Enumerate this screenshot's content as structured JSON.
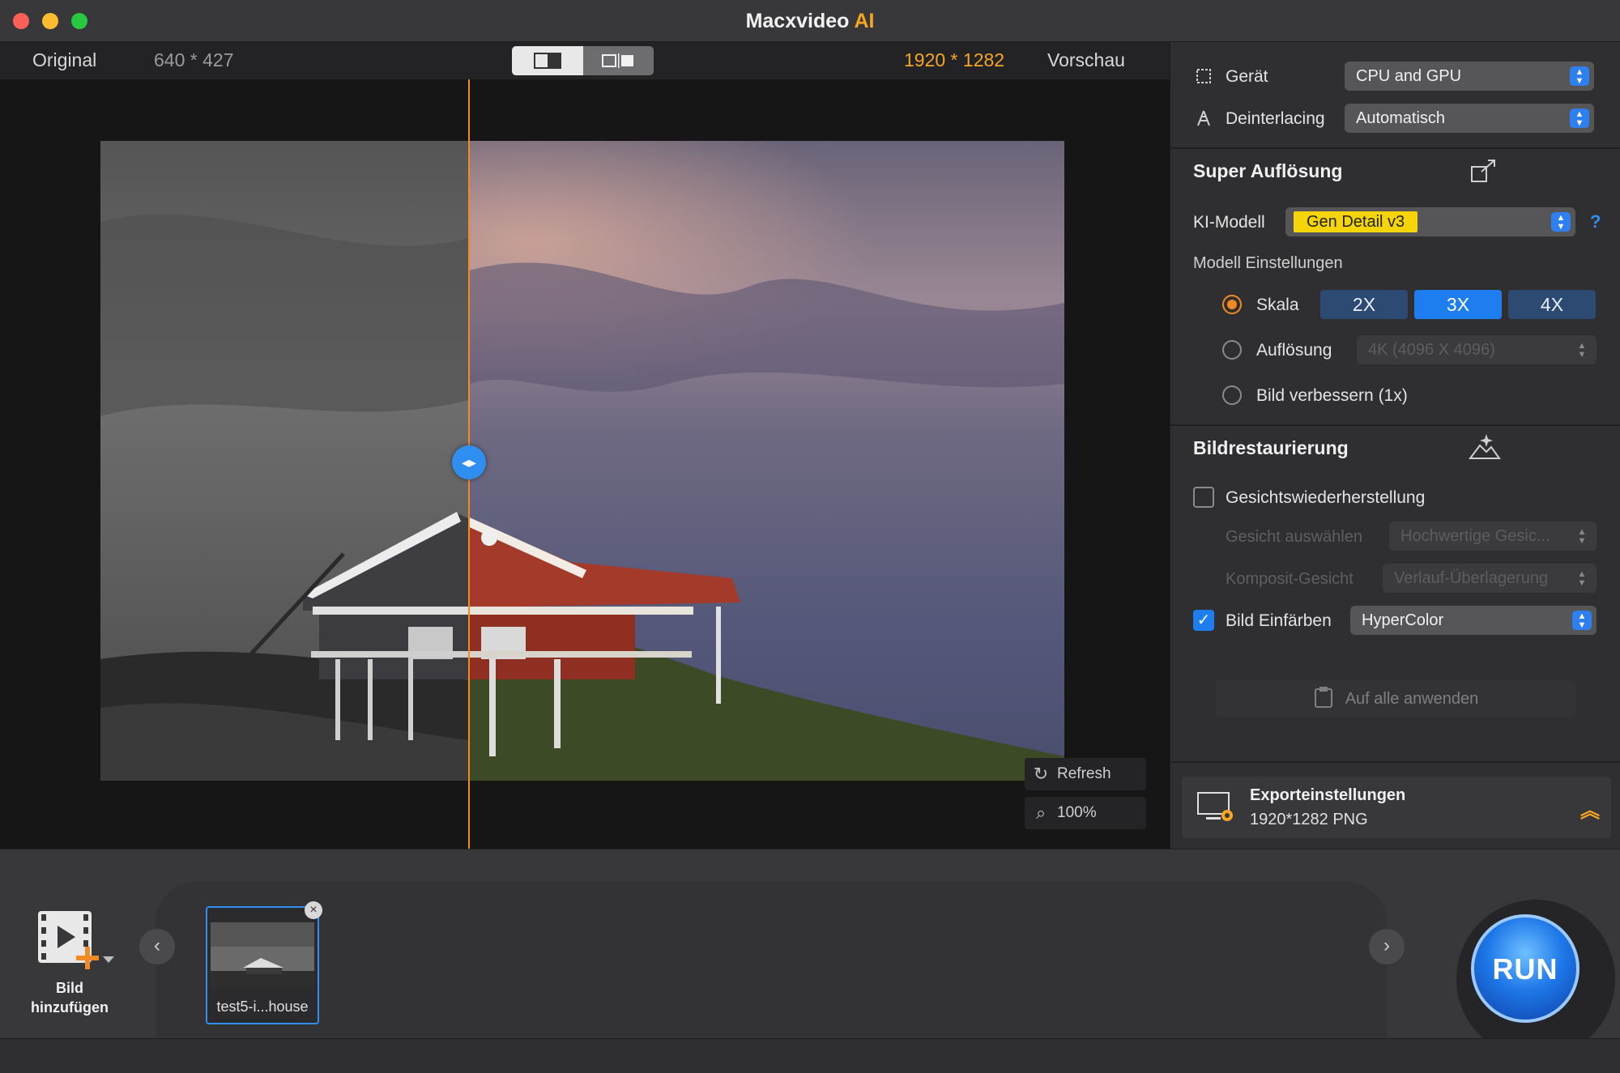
{
  "window": {
    "title_main": "Macxvideo",
    "title_accent": "AI"
  },
  "preview_header": {
    "original_label": "Original",
    "original_size": "640 * 427",
    "output_size": "1920 * 1282",
    "preview_label": "Vorschau"
  },
  "preview_controls": {
    "refresh_label": "Refresh",
    "zoom_label": "100%",
    "split_fraction": 0.38
  },
  "settings": {
    "device_label": "Gerät",
    "device_value": "CPU and GPU",
    "deinterlacing_label": "Deinterlacing",
    "deinterlacing_value": "Automatisch"
  },
  "super_resolution": {
    "title": "Super Auflösung",
    "model_label": "KI-Modell",
    "model_value": "Gen Detail v3",
    "help": "?",
    "model_settings_label": "Modell Einstellungen",
    "scale_label": "Skala",
    "scale_options": [
      "2X",
      "3X",
      "4X"
    ],
    "scale_selected": "3X",
    "resolution_label": "Auflösung",
    "resolution_value": "4K (4096 X 4096)",
    "enhance_label": "Bild verbessern (1x)"
  },
  "restoration": {
    "title": "Bildrestaurierung",
    "face_restore_label": "Gesichtswiederherstellung",
    "face_restore_checked": false,
    "face_select_label": "Gesicht auswählen",
    "face_select_value": "Hochwertige Gesic...",
    "composite_label": "Komposit-Gesicht",
    "composite_value": "Verlauf-Überlagerung",
    "colorize_label": "Bild Einfärben",
    "colorize_checked": true,
    "colorize_value": "HyperColor",
    "apply_all_label": "Auf alle anwenden"
  },
  "export": {
    "title": "Exporteinstellungen",
    "summary": "1920*1282 PNG"
  },
  "bottom": {
    "add_image_line1": "Bild",
    "add_image_line2": "hinzufügen",
    "thumb_label": "test5-i...house",
    "run_label": "RUN"
  },
  "colors": {
    "accent_orange": "#f5a623",
    "accent_blue": "#1e7ef0",
    "model_badge": "#f5d50a"
  }
}
